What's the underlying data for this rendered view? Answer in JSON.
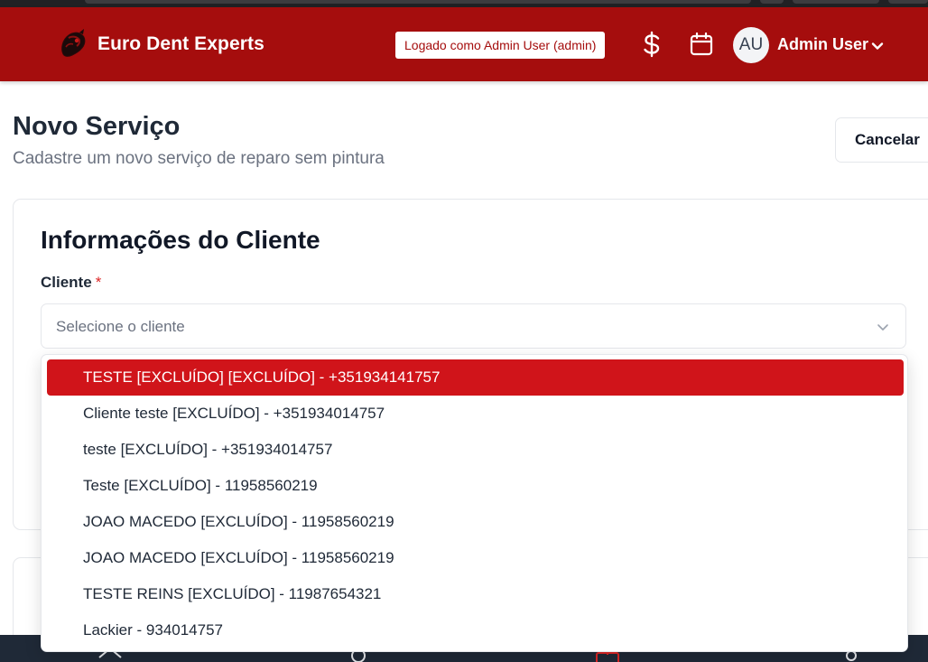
{
  "header": {
    "brand_name": "Euro Dent Experts",
    "login_badge": "Logado como Admin User (admin)",
    "avatar_initials": "AU",
    "user_name": "Admin User",
    "icons": [
      "dollar-icon",
      "calendar-icon",
      "chevron-down-icon"
    ],
    "brand_color": "#a50d0d"
  },
  "page": {
    "title": "Novo Serviço",
    "subtitle": "Cadastre um novo serviço de reparo sem pintura",
    "cancel_label": "Cancelar"
  },
  "client_section": {
    "title": "Informações do Cliente",
    "client_label": "Cliente",
    "required_mark": "*",
    "select_placeholder": "Selecione o cliente"
  },
  "dropdown": {
    "highlight_color": "#d0141a",
    "options": [
      {
        "label": "TESTE [EXCLUÍDO] [EXCLUÍDO] - +351934141757",
        "highlighted": true
      },
      {
        "label": "Cliente teste [EXCLUÍDO] - +351934014757",
        "highlighted": false
      },
      {
        "label": "teste [EXCLUÍDO] - +351934014757",
        "highlighted": false
      },
      {
        "label": "Teste [EXCLUÍDO] - 11958560219",
        "highlighted": false
      },
      {
        "label": "JOAO MACEDO [EXCLUÍDO] - 11958560219",
        "highlighted": false
      },
      {
        "label": "JOAO MACEDO [EXCLUÍDO] - 11958560219",
        "highlighted": false
      },
      {
        "label": "TESTE REINS [EXCLUÍDO] - 11987654321",
        "highlighted": false
      },
      {
        "label": "Lackier - 934014757",
        "highlighted": false
      }
    ]
  }
}
